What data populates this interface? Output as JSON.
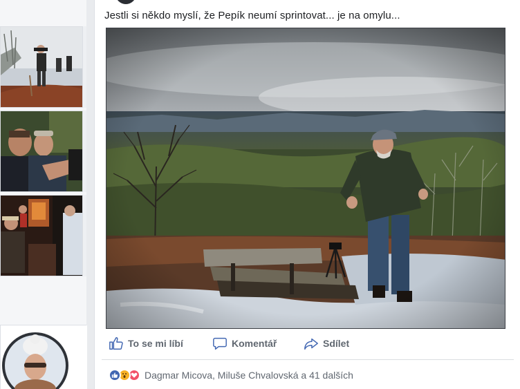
{
  "post": {
    "text": "Jestli si někdo myslí, že Pepík neumí sprintovat... je na omylu...",
    "actions": {
      "like": "To se mi líbí",
      "comment": "Komentář",
      "share": "Sdílet"
    },
    "reactions": {
      "icons": [
        "like-icon",
        "wow-icon",
        "love-icon"
      ],
      "names": "Dagmar Micova, Miluše Chvalovská a 41 dalších"
    }
  },
  "colors": {
    "like_blue": "#4267b2",
    "love_red": "#f25268",
    "wow_yellow": "#f7b125",
    "action_gray": "#606770"
  }
}
